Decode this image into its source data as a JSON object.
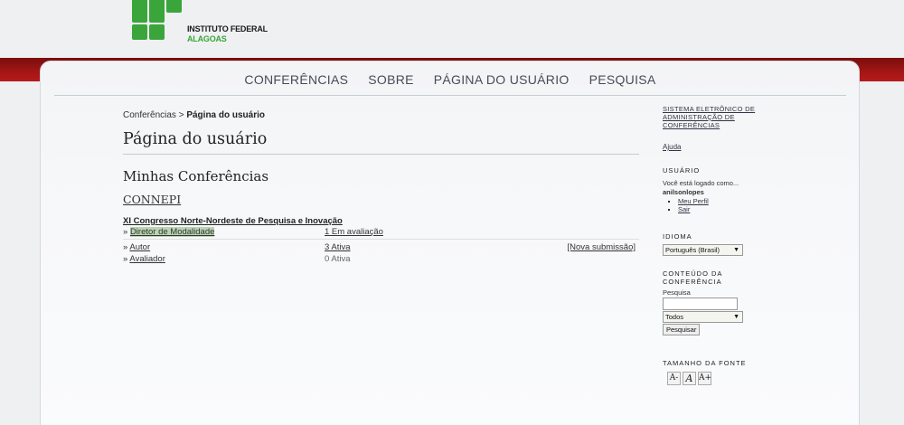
{
  "header": {
    "logo_line1": "INSTITUTO FEDERAL",
    "logo_line2": "ALAGOAS",
    "brand_color": "#3aa53a",
    "band_color": "#a51616"
  },
  "nav": {
    "items": [
      "CONFERÊNCIAS",
      "SOBRE",
      "PÁGINA DO USUÁRIO",
      "PESQUISA"
    ]
  },
  "breadcrumb": {
    "home": "Conferências",
    "separator": ">",
    "current": "Página do usuário"
  },
  "main": {
    "page_title": "Página do usuário",
    "section_title": "Minhas Conferências",
    "conference_link": "CONNEPI",
    "event_title": "XI Congresso Norte-Nordeste de Pesquisa e Inovação",
    "rows": [
      {
        "role": "Diretor de Modalidade",
        "status": "1 Em avaliação",
        "action": ""
      },
      {
        "role": "Autor",
        "status": "3 Ativa",
        "action": "[Nova submissão]"
      },
      {
        "role": "Avaliador",
        "status": "0 Ativa",
        "action": ""
      }
    ],
    "bullet": "»"
  },
  "sidebar": {
    "system_link": "SISTEMA ELETRÔNICO DE ADMINISTRAÇÃO DE CONFERÊNCIAS",
    "help": "Ajuda",
    "user_title": "USUÁRIO",
    "logged_as": "Você está logado como...",
    "username": "anilsonlopes",
    "my_profile": "Meu Perfil",
    "logout": "Sair",
    "language_title": "IDIOMA",
    "language_value": "Português (Brasil)",
    "content_title": "CONTEÚDO DA CONFERÊNCIA",
    "search_label": "Pesquisa",
    "search_value": "",
    "scope_value": "Todos",
    "search_button": "Pesquisar",
    "font_title": "TAMANHO DA FONTE",
    "font_icons": [
      "A-",
      "A",
      "A+"
    ]
  }
}
